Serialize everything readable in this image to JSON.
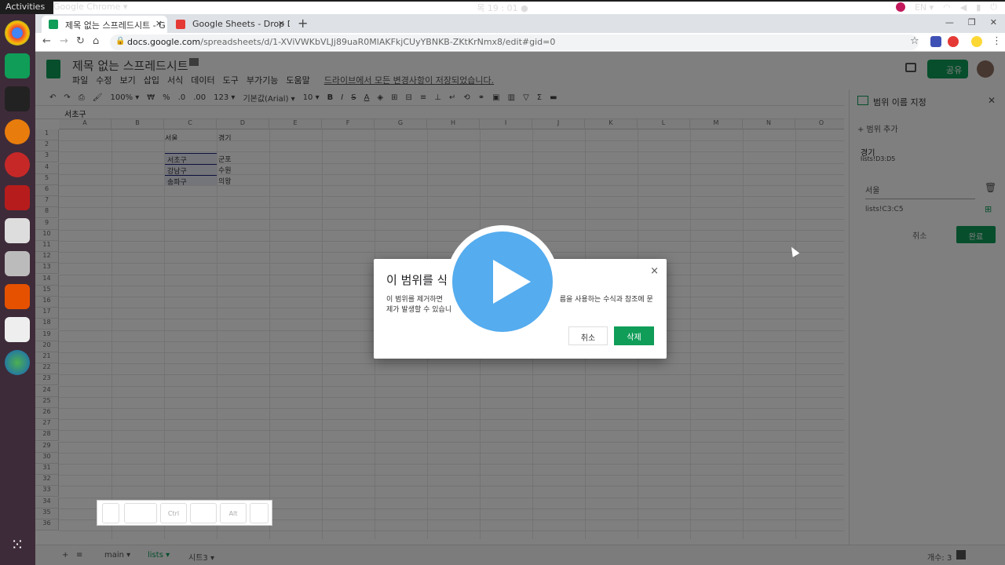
{
  "os": {
    "activities": "Activities",
    "app_name": "Google Chrome ▾",
    "clock": "목 19 : 01 ●",
    "lang": "EN ▾"
  },
  "browser": {
    "tabs": [
      {
        "label": "제목 없는 스프레드시트 - G",
        "color": "#0f9d58"
      },
      {
        "label": "Google Sheets - Drop Dov",
        "color": "#e53935"
      }
    ],
    "new_tab": "+",
    "url_host": "docs.google.com",
    "url_path": "/spreadsheets/d/1-XViVWKbVLJj89uaR0MlAKFkjCUyYBNKB-ZKtKrNmx8/edit#gid=0"
  },
  "sheets": {
    "doc_title": "제목 없는 스프레드시트",
    "menus": [
      "파일",
      "수정",
      "보기",
      "삽입",
      "서식",
      "데이터",
      "도구",
      "부가기능",
      "도움말"
    ],
    "save_notice": "드라이브에서 모든 변경사항이 저장되었습니다.",
    "share_label": "공유",
    "toolbar": {
      "zoom": "100% ▾",
      "currency": "₩",
      "percent": "%",
      "dec_less": ".0",
      "dec_more": ".00",
      "format": "123 ▾",
      "font": "기본값(Arial) ▾",
      "size": "10 ▾",
      "bold": "B",
      "italic": "I",
      "strike": "S",
      "textcolor": "A"
    },
    "formula_value": "서초구",
    "columns": [
      "A",
      "B",
      "C",
      "D",
      "E",
      "F",
      "G",
      "H",
      "I",
      "J",
      "K",
      "L",
      "M",
      "N",
      "O"
    ],
    "rows": [
      "1",
      "2",
      "3",
      "4",
      "5",
      "6",
      "7",
      "8",
      "9",
      "10",
      "11",
      "12",
      "13",
      "14",
      "15",
      "16",
      "17",
      "18",
      "19",
      "20",
      "21",
      "22",
      "23",
      "24",
      "25",
      "26",
      "27",
      "28",
      "29",
      "30",
      "31",
      "32",
      "33",
      "34",
      "35",
      "36"
    ],
    "cells": {
      "c1": "서울",
      "d1": "경기",
      "c3": "서초구",
      "d3": "군포",
      "c4": "강남구",
      "d4": "수원",
      "c5": "송파구",
      "d5": "의왕"
    },
    "sheet_tabs": {
      "main": "main ▾",
      "lists": "lists ▾",
      "sheet3": "시트3 ▾",
      "add": "+",
      "all": "≡",
      "count": "개수: 3"
    }
  },
  "panel": {
    "title": "범위 이름 지정",
    "add_range": "+ 범위 추가",
    "range_name": "경기",
    "range_ref": "lists!D3:D5",
    "edit_name": "서울",
    "edit_ref": "lists!C3:C5",
    "cancel": "취소",
    "done": "완료"
  },
  "dialog": {
    "title": "이 범위를 삭",
    "message_line1": "이 범위를 제거하면                                                    름을 사용하는 수식과 참조에 문",
    "message_line2": "제가 발생할 수 있습니",
    "cancel": "취소",
    "delete": "삭제",
    "close": "×"
  },
  "keys": [
    "",
    "",
    "Ctrl",
    "",
    "Alt",
    ""
  ]
}
